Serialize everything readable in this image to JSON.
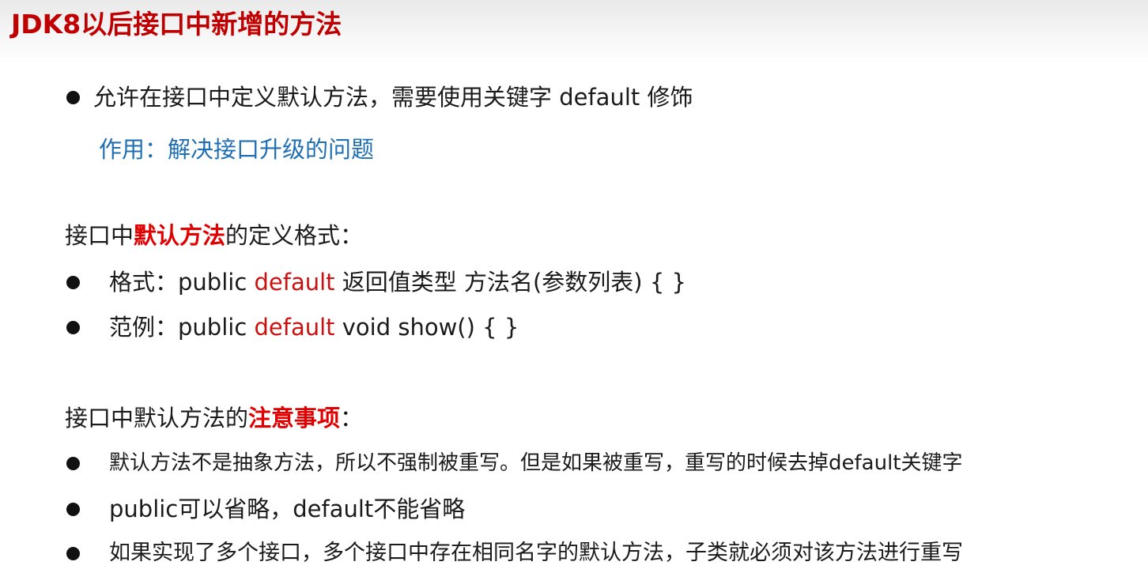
{
  "slide": {
    "title": "JDK8以后接口中新增的方法",
    "point1": {
      "text": "允许在接口中定义默认方法，需要使用关键字 default 修饰",
      "purpose": "作用：解决接口升级的问题"
    },
    "format_section": {
      "heading_prefix": "接口中",
      "heading_highlight": "默认方法",
      "heading_suffix": "的定义格式：",
      "items": [
        {
          "label": "格式：",
          "pre": "public ",
          "keyword": "default",
          "post": " 返回值类型 方法名(参数列表) {   }"
        },
        {
          "label": "范例：",
          "pre": "public ",
          "keyword": "default",
          "post": " void show() {   }"
        }
      ]
    },
    "notes_section": {
      "heading_prefix": "接口中默认方法的",
      "heading_highlight": "注意事项",
      "heading_suffix": "：",
      "items": [
        "默认方法不是抽象方法，所以不强制被重写。但是如果被重写，重写的时候去掉default关键字",
        "public可以省略，default不能省略",
        "如果实现了多个接口，多个接口中存在相同名字的默认方法，子类就必须对该方法进行重写"
      ]
    }
  },
  "colors": {
    "title": "#c00000",
    "keyword": "#cc1111",
    "highlight": "#e00000",
    "purpose": "#1f6fb2"
  }
}
